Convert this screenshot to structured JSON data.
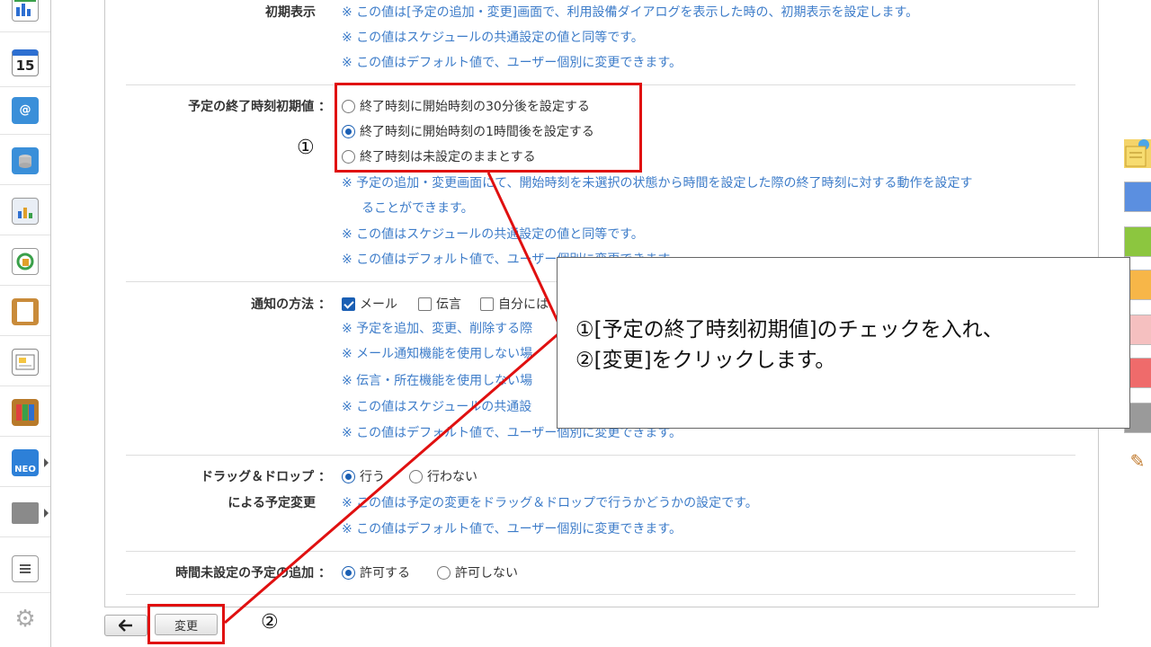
{
  "left_rail": {
    "items": [
      {
        "icon": "chart-icon"
      },
      {
        "icon": "calendar-icon",
        "text": "15"
      },
      {
        "icon": "mail-icon"
      },
      {
        "icon": "mail-database-icon"
      },
      {
        "icon": "report-icon"
      },
      {
        "icon": "workflow-icon"
      },
      {
        "icon": "clipboard-icon"
      },
      {
        "icon": "bulletin-board-icon"
      },
      {
        "icon": "binders-icon"
      },
      {
        "icon": "neo-icon",
        "text": "NEO"
      },
      {
        "icon": "folder-icon"
      },
      {
        "icon": "settings-list-icon"
      },
      {
        "icon": "gear-icon"
      }
    ]
  },
  "settings": {
    "initial_display": {
      "label": "初期表示",
      "notes": [
        "※ この値は[予定の追加・変更]画面で、利用設備ダイアログを表示した時の、初期表示を設定します。",
        "※ この値はスケジュールの共通設定の値と同等です。",
        "※ この値はデフォルト値で、ユーザー個別に変更できます。"
      ]
    },
    "end_time": {
      "label": "予定の終了時刻初期値 ：",
      "options": [
        {
          "label": "終了時刻に開始時刻の30分後を設定する",
          "selected": false
        },
        {
          "label": "終了時刻に開始時刻の1時間後を設定する",
          "selected": true
        },
        {
          "label": "終了時刻は未設定のままとする",
          "selected": false
        }
      ],
      "notes": [
        "※ 予定の追加・変更画面にて、開始時刻を未選択の状態から時間を設定した際の終了時刻に対する動作を設定す",
        "ることができます。",
        "※ この値はスケジュールの共通設定の値と同等です。",
        "※ この値はデフォルト値で、ユーザー個別に変更できます。"
      ]
    },
    "notify": {
      "label": "通知の方法 ：",
      "options": [
        {
          "label": "メール",
          "checked": true
        },
        {
          "label": "伝言",
          "checked": false
        },
        {
          "label": "自分には",
          "checked": false
        }
      ],
      "notes": [
        "※ 予定を追加、変更、削除する際",
        "※ メール通知機能を使用しない場",
        "※ 伝言・所在機能を使用しない場",
        "※ この値はスケジュールの共通設",
        "※ この値はデフォルト値で、ユーザー個別に変更できます。"
      ]
    },
    "drag_drop": {
      "label_line1": "ドラッグ＆ドロップ ：",
      "label_line2": "による予定変更",
      "options": [
        {
          "label": "行う",
          "selected": true
        },
        {
          "label": "行わない",
          "selected": false
        }
      ],
      "notes": [
        "※ この値は予定の変更をドラッグ＆ドロップで行うかどうかの設定です。",
        "※ この値はデフォルト値で、ユーザー個別に変更できます。"
      ]
    },
    "unset_time": {
      "label": "時間未設定の予定の追加 ：",
      "options": [
        {
          "label": "許可する",
          "selected": true
        },
        {
          "label": "許可しない",
          "selected": false
        }
      ]
    }
  },
  "buttons": {
    "back_icon": "back-arrow-icon",
    "submit_label": "変更"
  },
  "annotations": {
    "marker1": "①",
    "marker2": "②",
    "callout_line1": "①[予定の終了時刻初期値]のチェックを入れ、",
    "callout_line2": "②[変更]をクリックします。"
  },
  "colors": {
    "note_text": "#3d7cc9",
    "highlight": "#e01010",
    "radio_selected": "#1a5fb4"
  },
  "right_palette": {
    "items": [
      {
        "icon": "sticky-note-icon",
        "color": "#f4d46a"
      },
      {
        "color": "#5b8fe0"
      },
      {
        "color": "#8cc63f"
      },
      {
        "color": "#f7b648"
      },
      {
        "color": "#f5b6b6"
      },
      {
        "color": "#ef6b6b"
      },
      {
        "color": "#9a9a9a"
      },
      {
        "icon": "pencil-icon"
      }
    ]
  }
}
